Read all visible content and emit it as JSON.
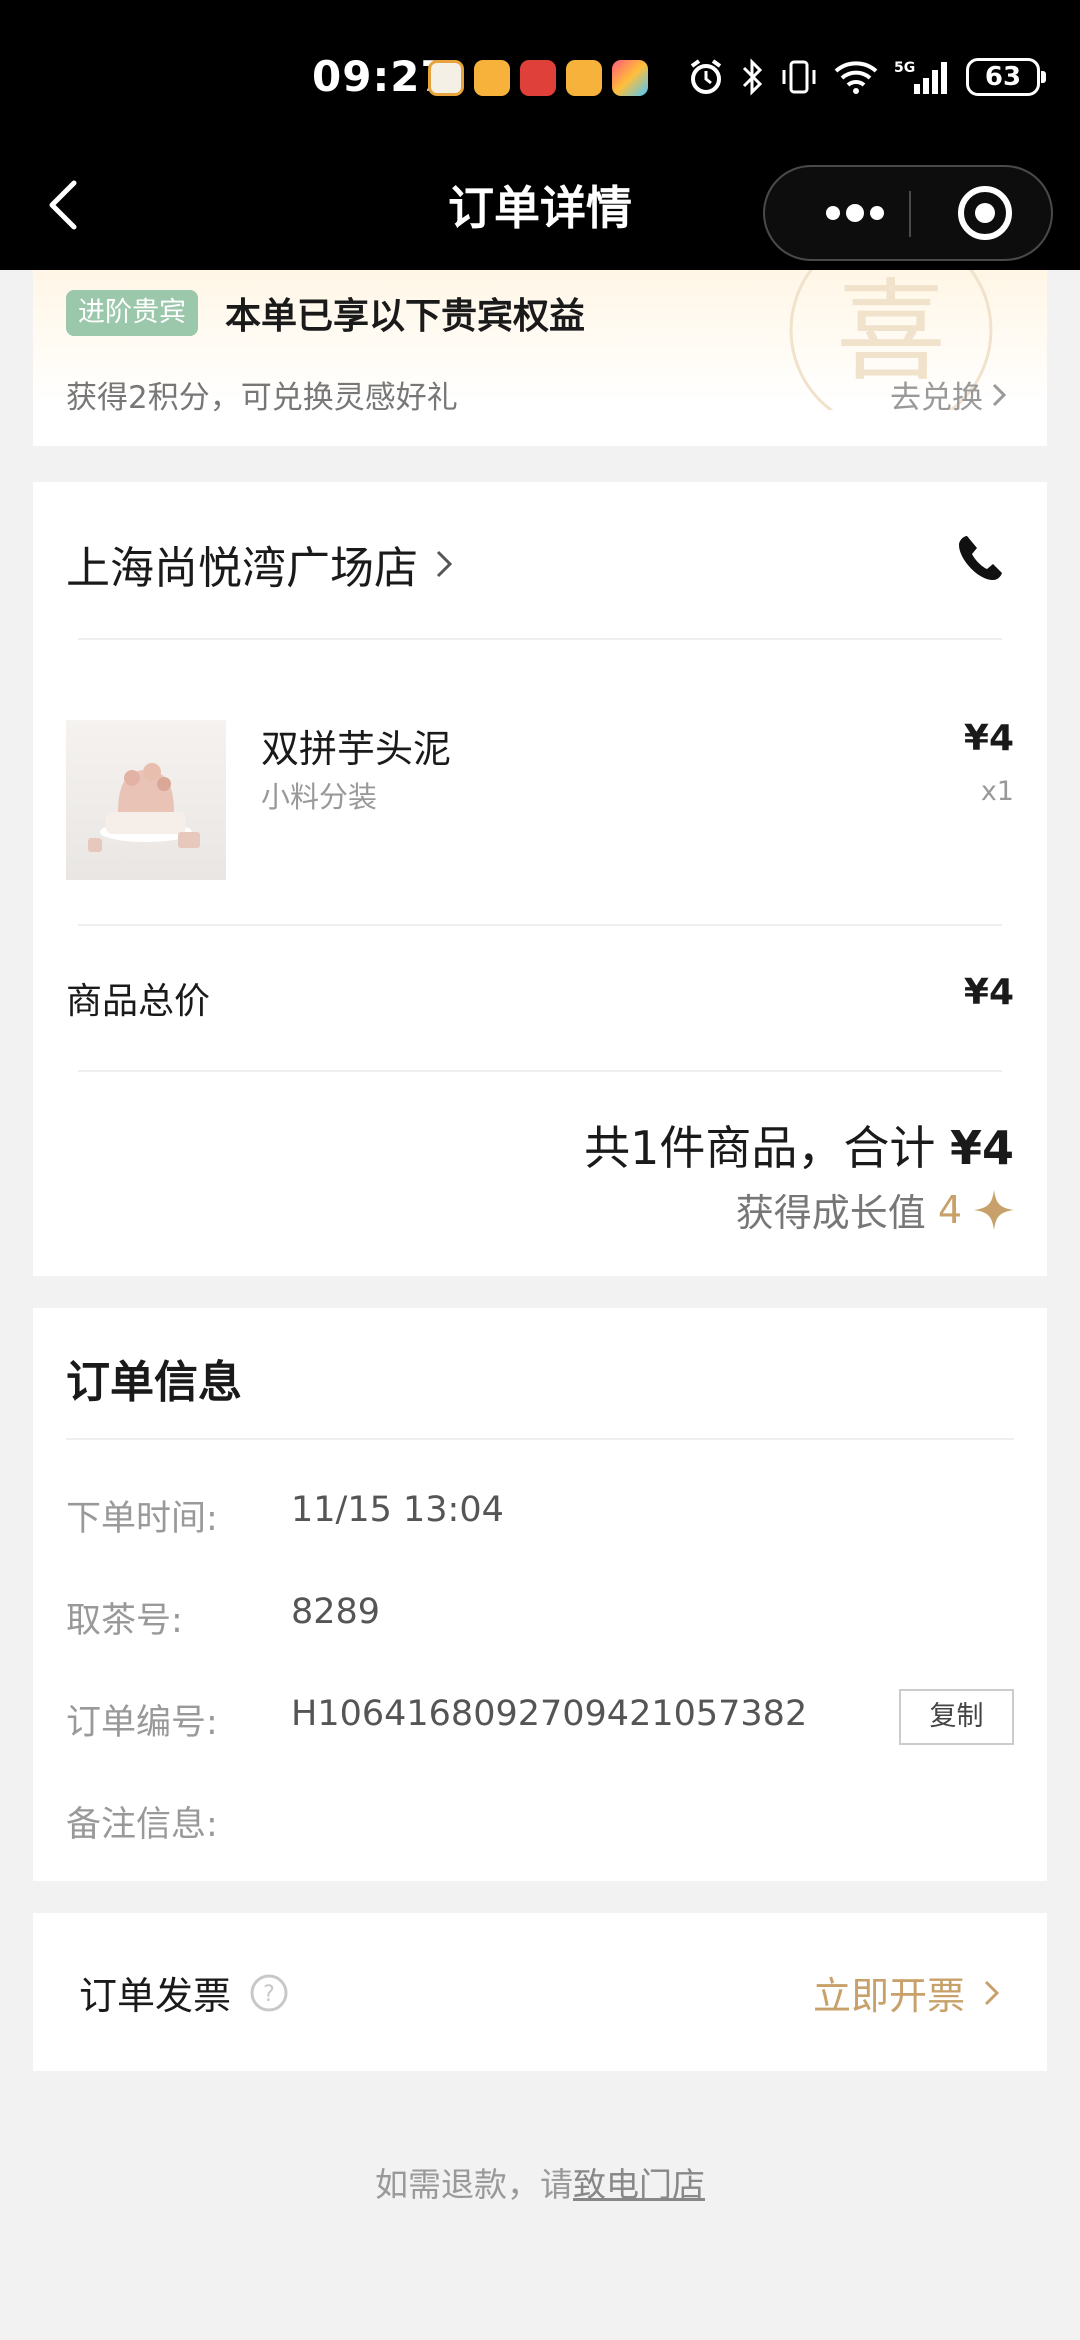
{
  "status_bar": {
    "time": "09:27",
    "battery": "63",
    "network": "5G"
  },
  "nav": {
    "title": "订单详情"
  },
  "vip": {
    "badge": "进阶贵宾",
    "title": "本单已享以下贵宾权益",
    "points_text": "获得2积分，可兑换灵感好礼",
    "redeem_link": "去兑换",
    "watermark": "喜"
  },
  "store": {
    "name": "上海尚悦湾广场店"
  },
  "product": {
    "name": "双拼芋头泥",
    "spec": "小料分装",
    "price": "¥4",
    "qty": "x1"
  },
  "subtotal": {
    "label": "商品总价",
    "value": "¥4"
  },
  "total": {
    "text": "共1件商品，合计",
    "amount": "¥4",
    "growth_label": "获得成长值",
    "growth_value": "4"
  },
  "order_info": {
    "title": "订单信息",
    "rows": [
      {
        "label": "下单时间:",
        "value": "11/15 13:04"
      },
      {
        "label": "取茶号:",
        "value": "8289"
      },
      {
        "label": "订单编号:",
        "value": "H1064168092709421057382"
      },
      {
        "label": "备注信息:",
        "value": ""
      }
    ],
    "copy_label": "复制"
  },
  "invoice": {
    "label": "订单发票",
    "action": "立即开票"
  },
  "footer": {
    "prefix": "如需退款，请",
    "link": "致电门店"
  },
  "colors": {
    "accent_gold": "#c8a06a",
    "badge_green": "#9bc7ab"
  }
}
